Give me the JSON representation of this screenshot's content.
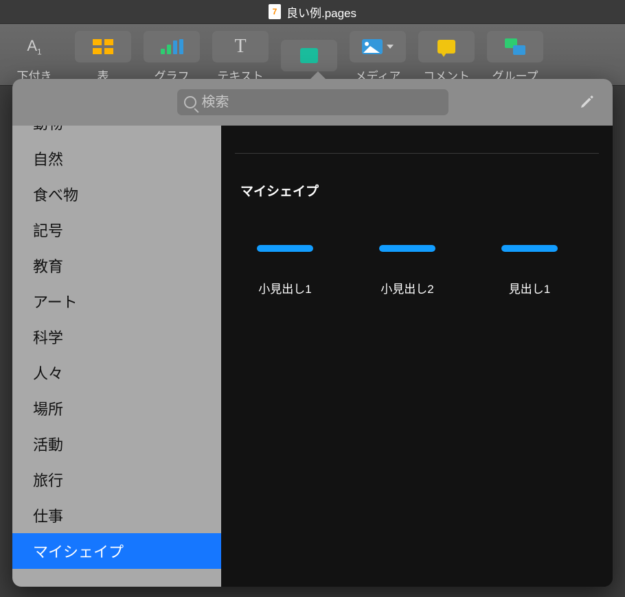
{
  "titlebar": {
    "filename": "良い例.pages"
  },
  "toolbar": {
    "items": [
      {
        "label": "下付き"
      },
      {
        "label": "表"
      },
      {
        "label": "グラフ"
      },
      {
        "label": "テキスト"
      },
      {
        "label": ""
      },
      {
        "label": "メディア"
      },
      {
        "label": "コメント"
      },
      {
        "label": "グループ"
      }
    ]
  },
  "popover": {
    "search_placeholder": "検索",
    "sidebar_items": [
      "動物",
      "自然",
      "食べ物",
      "記号",
      "教育",
      "アート",
      "科学",
      "人々",
      "場所",
      "活動",
      "旅行",
      "仕事",
      "マイシェイプ"
    ],
    "selected_index": 12,
    "section_title": "マイシェイプ",
    "shapes": [
      {
        "label": "小見出し1"
      },
      {
        "label": "小見出し2"
      },
      {
        "label": "見出し1"
      }
    ]
  }
}
